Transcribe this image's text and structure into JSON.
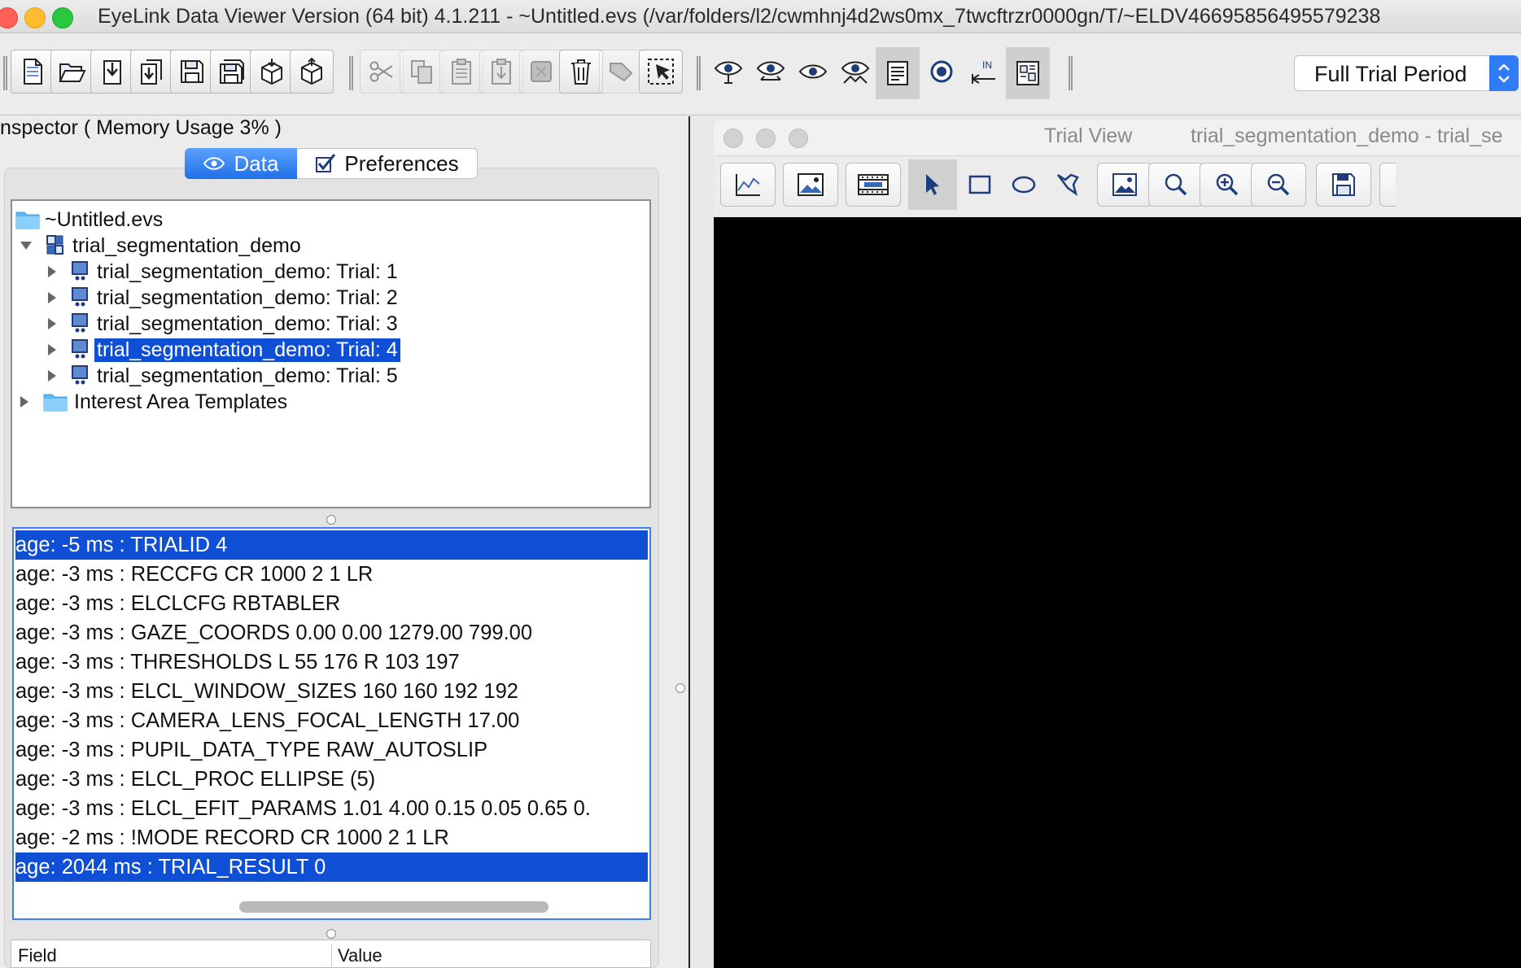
{
  "window": {
    "title": "EyeLink Data Viewer Version  (64 bit) 4.1.211 - ~Untitled.evs (/var/folders/l2/cwmhnj4d2ws0mx_7twcftrzr0000gn/T/~ELDV46695856495579238"
  },
  "toolbar": {
    "period_select": "Full Trial Period",
    "icons": [
      "new-file-icon",
      "open-folder-icon",
      "import-icon",
      "export-icon",
      "save-icon",
      "save-all-icon",
      "package-icon",
      "unpackage-icon",
      "cut-icon",
      "copy-icon",
      "paste-icon",
      "paste-special-icon",
      "disabled-icon",
      "delete-icon",
      "tag-icon",
      "select-icon",
      "eye-icon",
      "both-eyes-icon",
      "right-eye-icon",
      "eye-calibration-icon",
      "events-list-icon",
      "target-icon",
      "interest-period-icon",
      "layout-icon"
    ]
  },
  "inspector": {
    "title": "nspector ( Memory Usage 3% )",
    "tabs": {
      "data": "Data",
      "preferences": "Preferences"
    }
  },
  "tree": {
    "root": "~Untitled.evs",
    "session": "trial_segmentation_demo",
    "trials": [
      "trial_segmentation_demo: Trial: 1",
      "trial_segmentation_demo: Trial: 2",
      "trial_segmentation_demo: Trial: 3",
      "trial_segmentation_demo: Trial: 4",
      "trial_segmentation_demo: Trial: 5"
    ],
    "selected_trial": "trial_segmentation_demo: Trial: 4",
    "templates": "Interest Area Templates"
  },
  "events": [
    "age: -5 ms : TRIALID 4",
    "age: -3 ms : RECCFG CR 1000 2 1 LR",
    "age: -3 ms : ELCLCFG RBTABLER",
    "age: -3 ms : GAZE_COORDS 0.00 0.00 1279.00 799.00",
    "age: -3 ms : THRESHOLDS L 55 176  R 103 197",
    "age: -3 ms : ELCL_WINDOW_SIZES 160 160 192 192",
    "age: -3 ms : CAMERA_LENS_FOCAL_LENGTH 17.00",
    "age: -3 ms : PUPIL_DATA_TYPE RAW_AUTOSLIP",
    "age: -3 ms : ELCL_PROC ELLIPSE  (5)",
    "age: -3 ms : ELCL_EFIT_PARAMS 1.01 4.00  0.15 0.05  0.65 0.",
    "age: -2 ms : !MODE RECORD CR 1000 2 1 LR",
    "age: 2044 ms : TRIAL_RESULT 0"
  ],
  "highlighted_events": [
    0,
    11
  ],
  "properties": {
    "field_header": "Field",
    "value_header": "Value"
  },
  "trial_view": {
    "title": "Trial View",
    "subtitle": "trial_segmentation_demo - trial_se"
  },
  "colors": {
    "selection": "#0f4fd6",
    "accent": "#2f7cf6",
    "canvas": "#000000"
  }
}
